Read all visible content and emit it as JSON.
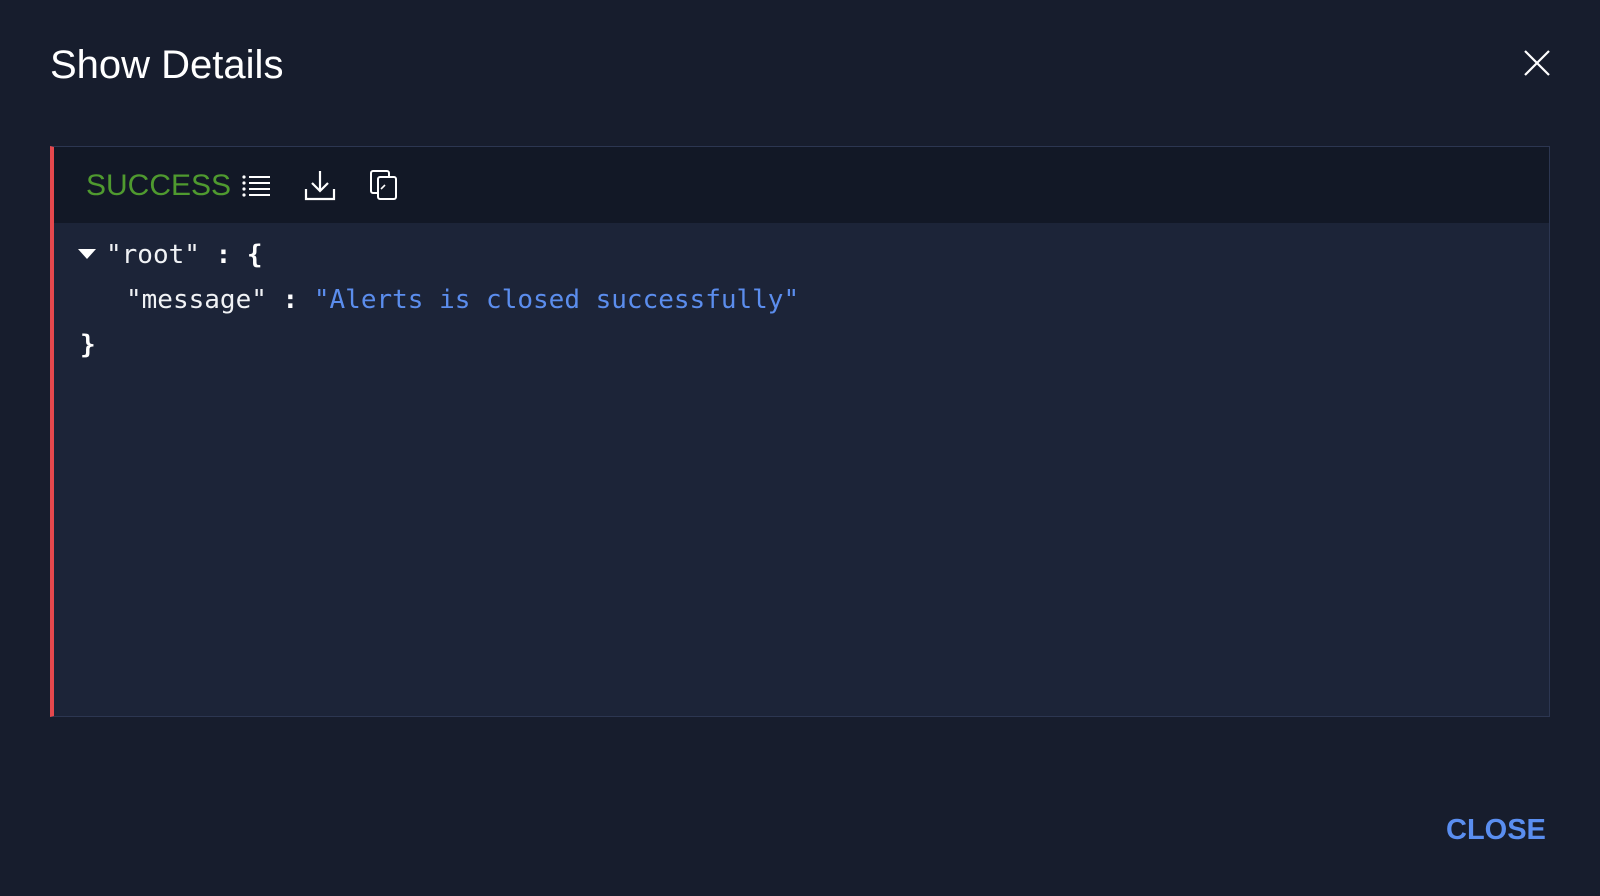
{
  "dialog": {
    "title": "Show Details",
    "close_action_label": "CLOSE"
  },
  "response": {
    "status": "SUCCESS",
    "status_color": "#4f9a2f",
    "tree": {
      "root_key": "\"root\"",
      "colon": ":",
      "open_brace": "{",
      "close_brace": "}",
      "entries": [
        {
          "key": "\"message\"",
          "value": "\"Alerts is closed successfully\""
        }
      ]
    }
  },
  "icons": {
    "close": "close-icon",
    "list": "list-icon",
    "download": "download-icon",
    "copy": "copy-icon"
  },
  "colors": {
    "background": "#171d2d",
    "error_accent": "#e5484d",
    "link": "#5a8ef0",
    "string_value": "#5b8ded"
  }
}
